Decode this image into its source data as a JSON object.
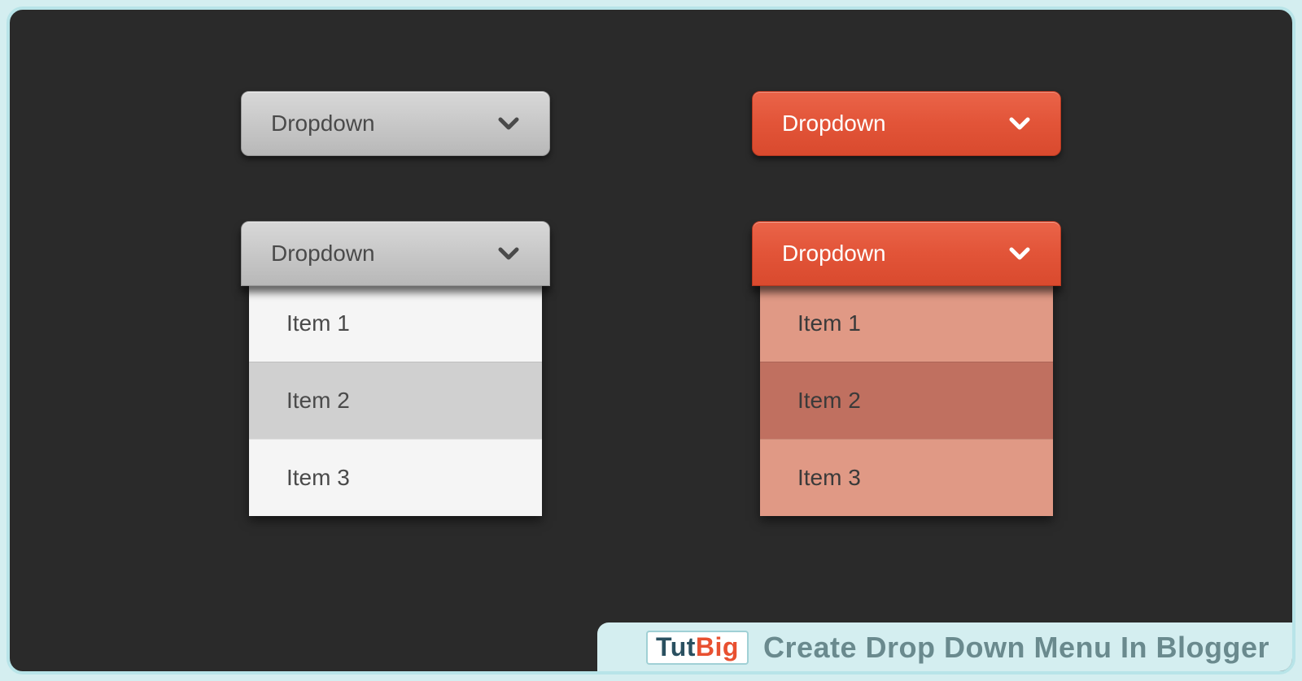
{
  "dropdowns": {
    "gray_closed": {
      "label": "Dropdown"
    },
    "red_closed": {
      "label": "Dropdown"
    },
    "gray_open": {
      "label": "Dropdown",
      "items": [
        "Item 1",
        "Item 2",
        "Item 3"
      ]
    },
    "red_open": {
      "label": "Dropdown",
      "items": [
        "Item 1",
        "Item 2",
        "Item 3"
      ]
    }
  },
  "banner": {
    "logo_part1": "Tut",
    "logo_part2": "Big",
    "title": "Create Drop Down Menu In Blogger"
  },
  "colors": {
    "accent_red": "#e25438",
    "accent_gray": "#c8c8c8",
    "background": "#2a2a2a",
    "frame": "#d4eef0"
  }
}
